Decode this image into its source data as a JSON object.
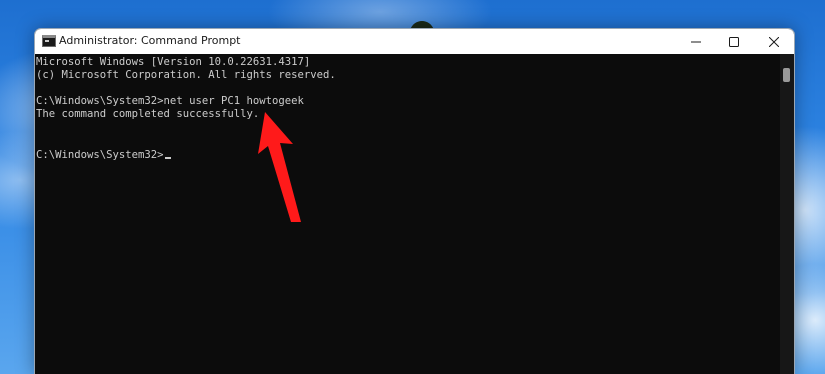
{
  "window": {
    "title": "Administrator: Command Prompt",
    "icon": "command-prompt-icon",
    "controls": {
      "minimize_icon": "minimize-icon",
      "maximize_icon": "maximize-icon",
      "close_icon": "close-icon"
    }
  },
  "terminal": {
    "lines": [
      "Microsoft Windows [Version 10.0.22631.4317]",
      "(c) Microsoft Corporation. All rights reserved.",
      "",
      "C:\\Windows\\System32>net user PC1 howtogeek",
      "The command completed successfully.",
      "",
      "",
      "C:\\Windows\\System32>"
    ],
    "text_color": "#cccccc",
    "background_color": "#0c0c0c"
  },
  "annotation": {
    "icon": "red-arrow-icon",
    "color": "#ff1a1a"
  }
}
